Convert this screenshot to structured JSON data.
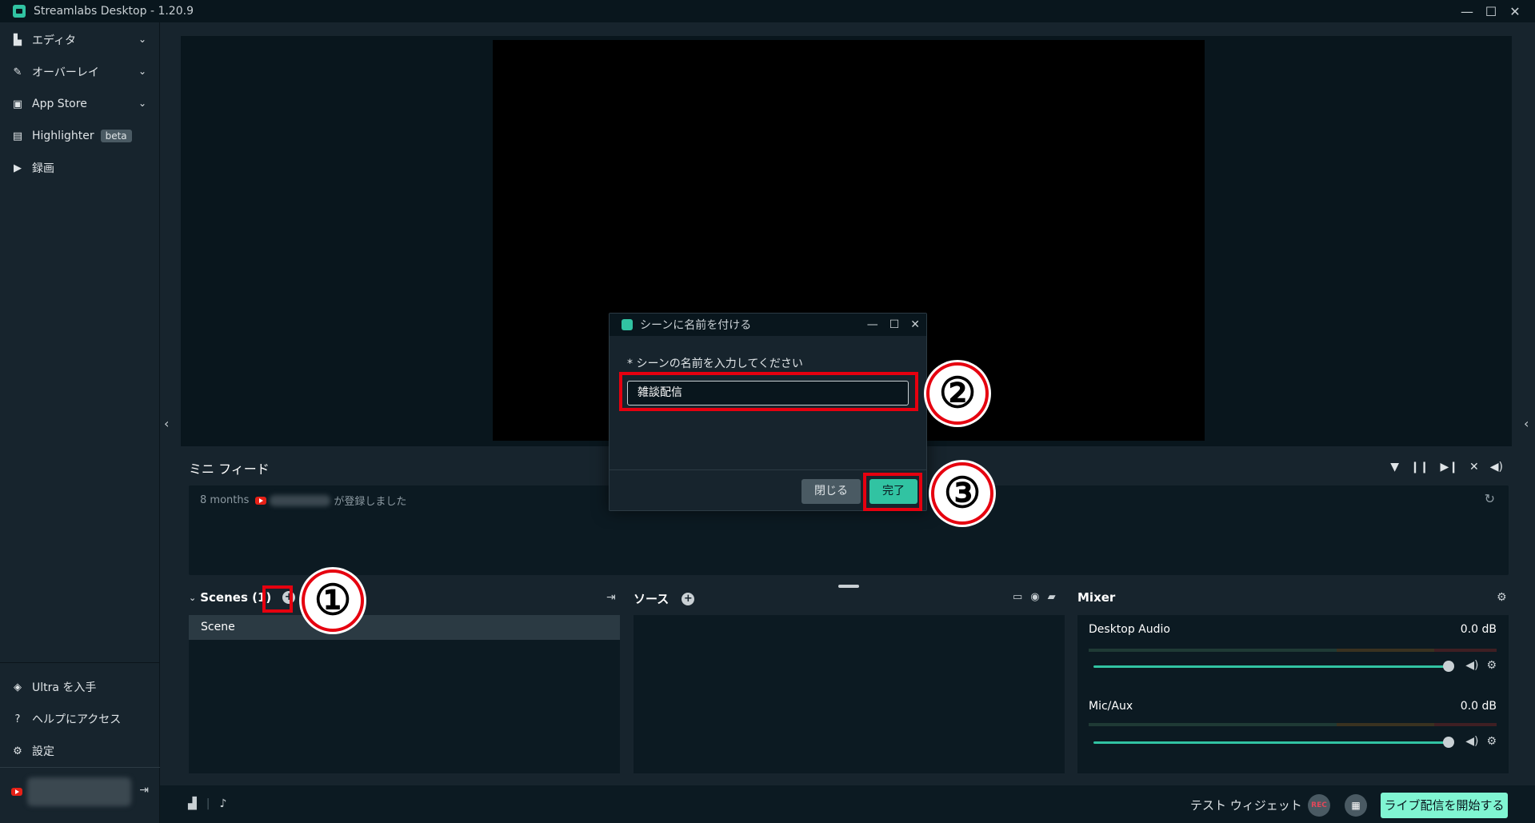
{
  "window": {
    "title": "Streamlabs Desktop - 1.20.9",
    "controls": {
      "minimize": "—",
      "maximize": "☐",
      "close": "✕"
    }
  },
  "sidebar": {
    "items": [
      {
        "label": "エディタ",
        "icon": "editor-icon",
        "has_chevron": true
      },
      {
        "label": "オーバーレイ",
        "icon": "overlay-brush-icon",
        "has_chevron": true
      },
      {
        "label": "App Store",
        "icon": "store-icon",
        "has_chevron": true
      },
      {
        "label": "Highlighter",
        "icon": "clapperboard-icon",
        "badge": "beta"
      },
      {
        "label": "録画",
        "icon": "play-circle-icon"
      }
    ],
    "bottom_items": [
      {
        "label": "Ultra を入手",
        "icon": "ultra-icon"
      },
      {
        "label": "ヘルプにアクセス",
        "icon": "help-icon"
      },
      {
        "label": "設定",
        "icon": "gear-icon"
      }
    ],
    "account": {
      "platform_icon": "youtube-icon",
      "logout_icon": "logout-icon"
    }
  },
  "minifeed": {
    "title": "ミニ フィード",
    "entry_time": "8 months",
    "entry_text": "が登録しました",
    "tools": [
      "filter-icon",
      "pause-icon",
      "skip-icon",
      "mute-alerts-icon",
      "volume-icon"
    ]
  },
  "scenes": {
    "title": "Scenes (1)",
    "items": [
      "Scene"
    ]
  },
  "sources": {
    "title": "ソース"
  },
  "mixer": {
    "title": "Mixer",
    "channels": [
      {
        "name": "Desktop Audio",
        "db": "0.0 dB",
        "level": 1.0
      },
      {
        "name": "Mic/Aux",
        "db": "0.0 dB",
        "level": 1.0
      }
    ]
  },
  "footer": {
    "test_widget": "テスト ウィジェット",
    "rec": "REC",
    "go_live": "ライブ配信を開始する"
  },
  "dialog": {
    "title": "シーンに名前を付ける",
    "label": "* シーンの名前を入力してください",
    "input_value": "雑談配信",
    "close_button": "閉じる",
    "done_button": "完了"
  },
  "annotations": {
    "step1": "①",
    "step2": "②",
    "step3": "③",
    "highlight_color": "#e6000f"
  },
  "colors": {
    "accent": "#31c3a2",
    "go_live": "#80f5d2",
    "background": "#17242d",
    "dark": "#09161d"
  }
}
